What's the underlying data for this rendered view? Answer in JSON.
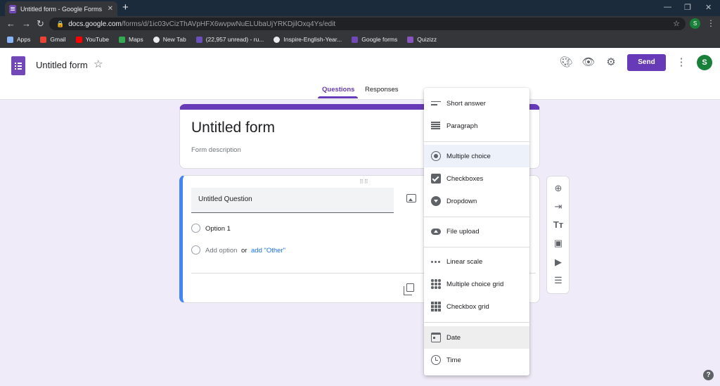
{
  "browser": {
    "tab_title": "Untitled form - Google Forms",
    "tab_close": "✕",
    "new_tab": "+",
    "url_host": "docs.google.com",
    "url_path": "/forms/d/1ic03vCizThAVpHFX6wvpwNuELUbaUjYRKDjilOxq4Ys/edit",
    "profile_initial": "S",
    "bookmarks": [
      {
        "label": "Apps",
        "color": "#8ab4f8"
      },
      {
        "label": "Gmail",
        "color": "#ea4335"
      },
      {
        "label": "YouTube",
        "color": "#ff0000"
      },
      {
        "label": "Maps",
        "color": "#34a853"
      },
      {
        "label": "New Tab",
        "color": "#e8eaed"
      },
      {
        "label": "(22,957 unread) - ru...",
        "color": "#6b4fbb"
      },
      {
        "label": "Inspire-English-Year...",
        "color": "#e8eaed"
      },
      {
        "label": "Google forms",
        "color": "#7248b9"
      },
      {
        "label": "Quizizz",
        "color": "#8854c0"
      }
    ]
  },
  "forms_header": {
    "title": "Untitled form",
    "send_label": "Send",
    "avatar_initial": "S",
    "tabs": [
      "Questions",
      "Responses"
    ]
  },
  "title_card": {
    "title": "Untitled form",
    "description_placeholder": "Form description"
  },
  "question_card": {
    "question_text": "Untitled Question",
    "option_1": "Option 1",
    "add_option": "Add option",
    "or": "or",
    "add_other": "add \"Other\""
  },
  "type_menu": {
    "items": [
      "Short answer",
      "Paragraph",
      "Multiple choice",
      "Checkboxes",
      "Dropdown",
      "File upload",
      "Linear scale",
      "Multiple choice grid",
      "Checkbox grid",
      "Date",
      "Time"
    ]
  },
  "colors": {
    "accent": "#673ab7",
    "question_highlight": "#4285f4",
    "background": "#f0ebf8"
  }
}
